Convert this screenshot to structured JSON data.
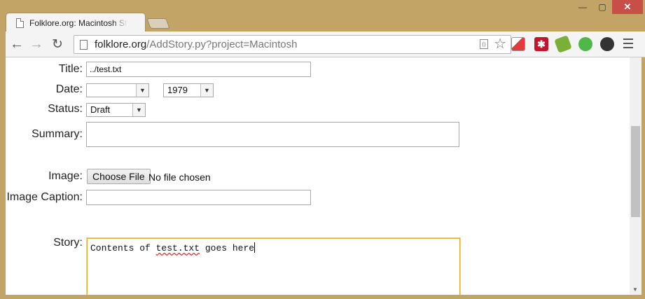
{
  "window": {
    "minimize": "—",
    "maximize": "▢",
    "close": "✕"
  },
  "tab": {
    "title": "Folklore.org: Macintosh Stories"
  },
  "toolbar": {
    "url_host": "folklore.org",
    "url_path": "/AddStory.py?project=Macintosh"
  },
  "form": {
    "title_label": "Title:",
    "title_value": "../test.txt",
    "date_label": "Date:",
    "date_month_value": "",
    "date_year_value": "1979",
    "status_label": "Status:",
    "status_value": "Draft",
    "summary_label": "Summary:",
    "image_label": "Image:",
    "choose_file_label": "Choose File",
    "no_file_text": "No file chosen",
    "caption_label": "Image Caption:",
    "caption_value": "",
    "story_label": "Story:",
    "story_pre": "Contents of ",
    "story_misspelled": "test.txt",
    "story_post": " goes here"
  }
}
